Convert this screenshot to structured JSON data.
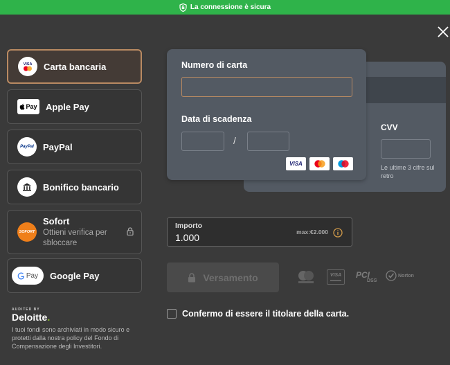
{
  "topbar": {
    "secure_text": "La connessione è sicura"
  },
  "methods": [
    {
      "label": "Carta bancaria"
    },
    {
      "label": "Apple Pay",
      "badge": "Pay"
    },
    {
      "label": "PayPal",
      "badge": "PayPal"
    },
    {
      "label": "Bonifico bancario"
    },
    {
      "label": "Sofort",
      "badge": "SOFORT",
      "sub": "Ottieni verifica per sbloccare"
    },
    {
      "label": "Google Pay",
      "badge": "Pay"
    }
  ],
  "card_badges": {
    "visa": "VISA"
  },
  "card": {
    "number_label": "Numero di carta",
    "expiry_label": "Data di scadenza",
    "expiry_separator": "/",
    "cvv_label": "CVV",
    "cvv_hint": "Le ultime 3 cifre sul retro"
  },
  "amount": {
    "label": "Importo",
    "value": "1.000",
    "max": "max:€2.000"
  },
  "deposit": {
    "label": "Versamento"
  },
  "trust": {
    "visa": "VISA",
    "pci": "PCI",
    "pci_dss": "DSS",
    "norton": "Norton"
  },
  "confirm": {
    "label": "Confermo di essere il titolare della carta."
  },
  "footer": {
    "audited": "AUDITED BY",
    "deloitte": "Deloitte",
    "deloitte_dot": ".",
    "policy": "I tuoi fondi sono archiviati in modo sicuro e protetti dalla nostra policy del Fondo di Compensazione degli Investitori."
  },
  "colors": {
    "topbar": "#2fb34a",
    "accent": "#b98a62",
    "background": "#3a3a3a",
    "card": "#535a63"
  },
  "icons": [
    "shield-lock-icon",
    "close-icon",
    "visa-mastercard-icon",
    "apple-icon",
    "paypal-icon",
    "bank-icon",
    "sofort-icon",
    "lock-icon",
    "google-icon",
    "info-icon"
  ]
}
